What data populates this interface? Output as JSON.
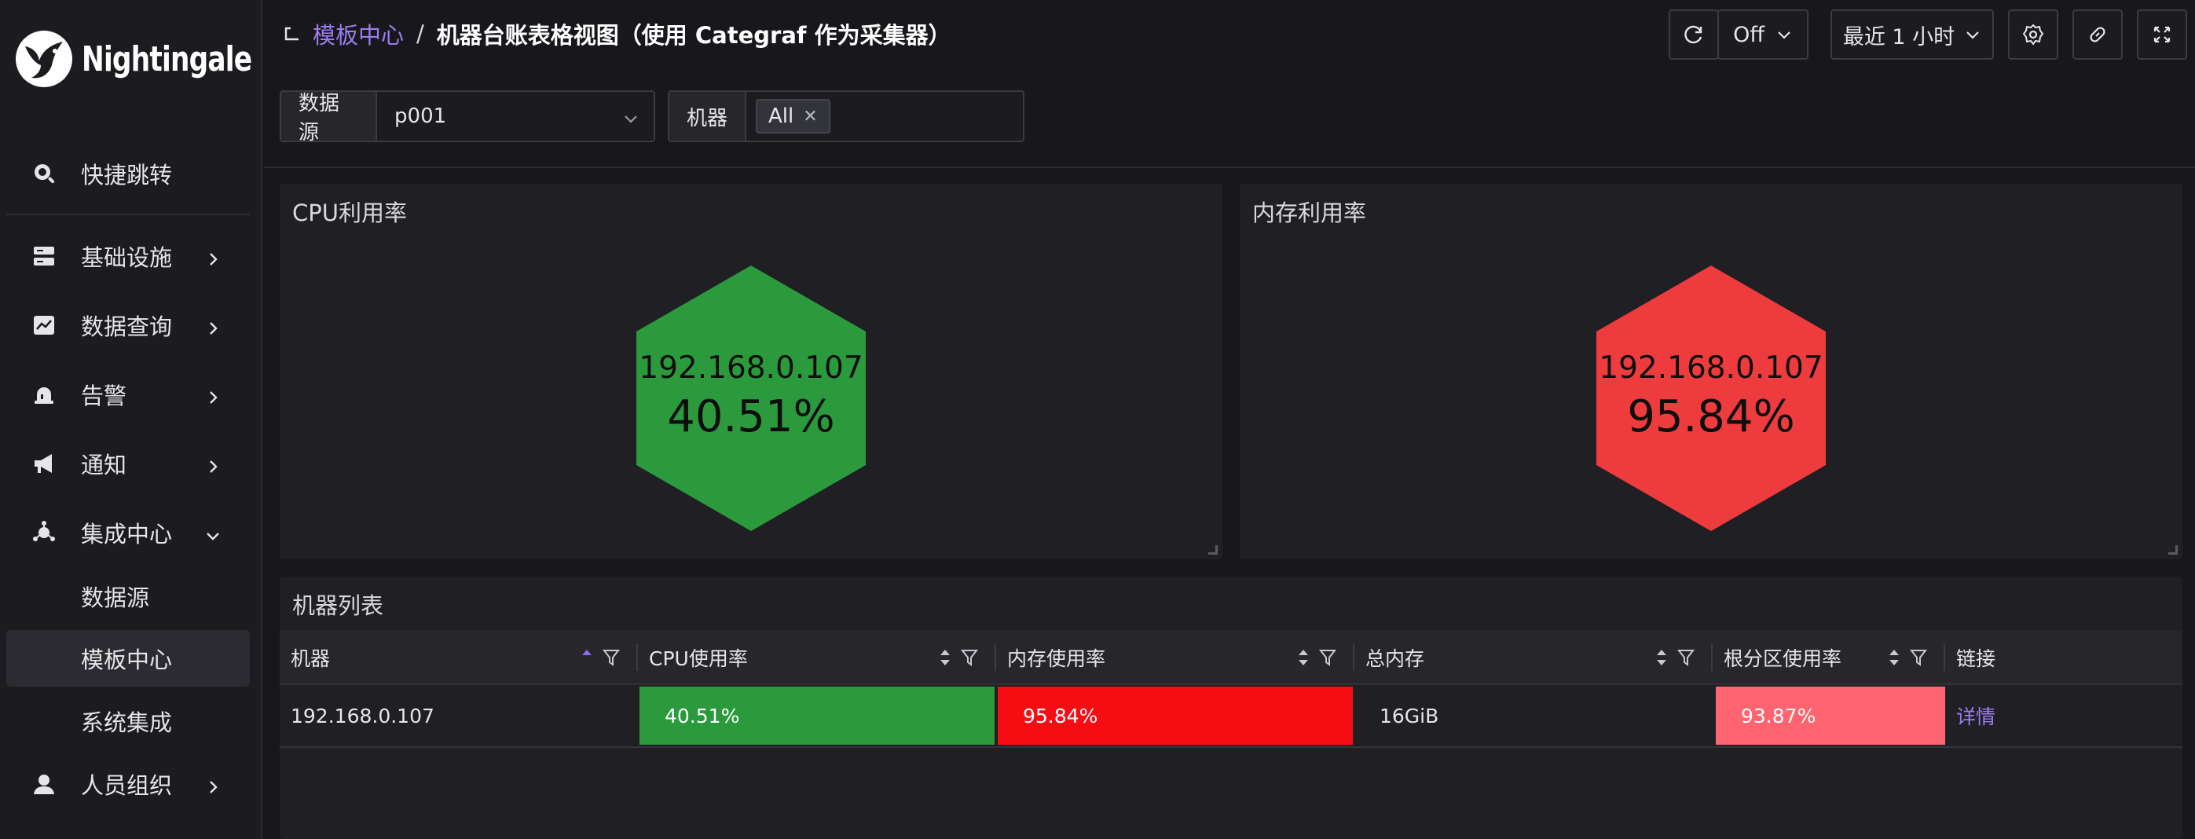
{
  "brand": {
    "name": "Nightingale"
  },
  "sidebar": {
    "items": [
      {
        "label": "快捷跳转",
        "icon": "search-icon"
      },
      {
        "label": "基础设施",
        "icon": "server-icon"
      },
      {
        "label": "数据查询",
        "icon": "chart-icon"
      },
      {
        "label": "告警",
        "icon": "alarm-icon"
      },
      {
        "label": "通知",
        "icon": "megaphone-icon"
      },
      {
        "label": "集成中心",
        "icon": "integration-icon"
      },
      {
        "label": "人员组织",
        "icon": "user-icon"
      }
    ],
    "sub_items": [
      {
        "label": "数据源"
      },
      {
        "label": "模板中心",
        "active": true
      },
      {
        "label": "系统集成"
      }
    ]
  },
  "header": {
    "breadcrumb_parent": "模板中心",
    "breadcrumb_separator": "/",
    "breadcrumb_current": "机器台账表格视图（使用 Categraf 作为采集器）",
    "refresh_interval": "Off",
    "time_range": "最近 1 小时"
  },
  "filters": {
    "datasource_label": "数据源",
    "datasource_value": "p001",
    "machine_label": "机器",
    "machine_tag": "All"
  },
  "panels": {
    "cpu": {
      "title": "CPU利用率",
      "ip": "192.168.0.107",
      "value": "40.51%",
      "color": "#2b9a3d"
    },
    "mem": {
      "title": "内存利用率",
      "ip": "192.168.0.107",
      "value": "95.84%",
      "color": "#ee3b3d"
    }
  },
  "table": {
    "title": "机器列表",
    "columns": [
      "机器",
      "CPU使用率",
      "内存使用率",
      "总内存",
      "根分区使用率",
      "链接"
    ],
    "rows": [
      {
        "machine": "192.168.0.107",
        "cpu": "40.51%",
        "mem": "95.84%",
        "total_mem": "16GiB",
        "root_disk": "93.87%",
        "link": "详情"
      }
    ],
    "colors": {
      "cpu": "#2b9a3d",
      "mem": "#f50d13",
      "root_disk": "#ff6470"
    }
  }
}
